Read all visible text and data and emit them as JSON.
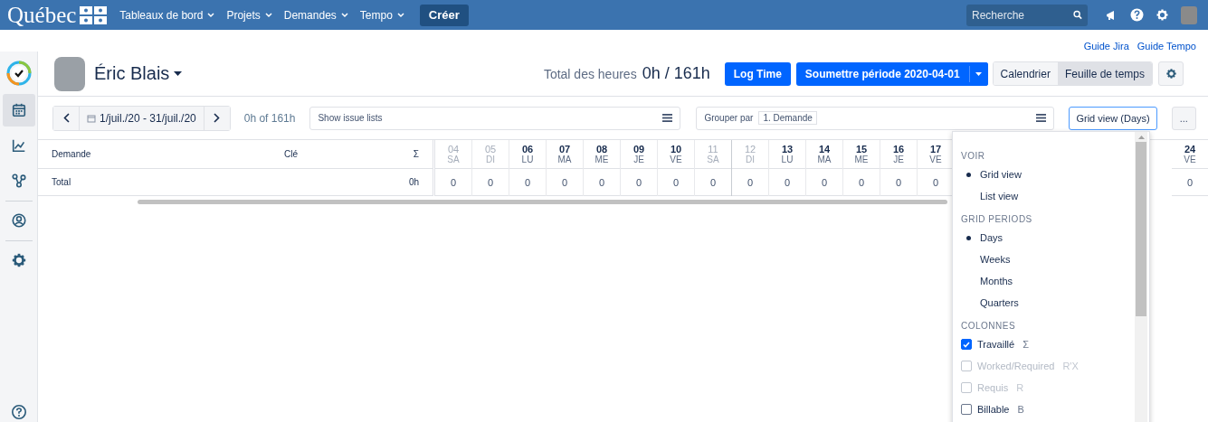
{
  "topnav": {
    "logo": "Québec",
    "menus": [
      {
        "label": "Tableaux de bord"
      },
      {
        "label": "Projets"
      },
      {
        "label": "Demandes"
      },
      {
        "label": "Tempo"
      }
    ],
    "create": "Créer",
    "search": {
      "placeholder": "Recherche"
    }
  },
  "links": [
    "Guide Jira",
    "Guide Tempo"
  ],
  "sidebar": {
    "items": [
      {
        "selected": true
      },
      {
        "selected": false
      },
      {
        "selected": false
      },
      {
        "selected": false
      },
      {
        "selected": false
      }
    ]
  },
  "header": {
    "user": "Éric Blais",
    "total_label": "Total des heures",
    "total_value": "0h / 161h",
    "log_time": "Log Time",
    "submit": "Soumettre période 2020-04-01",
    "view_tabs": [
      {
        "label": "Calendrier",
        "selected": false
      },
      {
        "label": "Feuille de temps",
        "selected": true
      }
    ]
  },
  "toolbar": {
    "date_range": "1/juil./20 - 31/juil./20",
    "hours": "0h of 161h",
    "issue_lists": "Show issue lists",
    "group_label": "Grouper par",
    "group_tag": "1. Demande",
    "view_button": "Grid view (Days)",
    "more": "..."
  },
  "table": {
    "columns": [
      "Demande",
      "Clé",
      "Σ"
    ],
    "total_row": {
      "label": "Total",
      "sum": "0h"
    },
    "days": [
      {
        "num": "04",
        "day": "SA",
        "weekend": true,
        "total": "0"
      },
      {
        "num": "05",
        "day": "DI",
        "weekend": true,
        "total": "0"
      },
      {
        "num": "06",
        "day": "LU",
        "weekend": false,
        "total": "0"
      },
      {
        "num": "07",
        "day": "MA",
        "weekend": false,
        "total": "0"
      },
      {
        "num": "08",
        "day": "ME",
        "weekend": false,
        "total": "0"
      },
      {
        "num": "09",
        "day": "JE",
        "weekend": false,
        "total": "0"
      },
      {
        "num": "10",
        "day": "VE",
        "weekend": false,
        "total": "0"
      },
      {
        "num": "11",
        "day": "SA",
        "weekend": true,
        "total": "0"
      },
      {
        "num": "12",
        "day": "DI",
        "weekend": true,
        "total": "0"
      },
      {
        "num": "13",
        "day": "LU",
        "weekend": false,
        "total": "0"
      },
      {
        "num": "14",
        "day": "MA",
        "weekend": false,
        "total": "0"
      },
      {
        "num": "15",
        "day": "ME",
        "weekend": false,
        "total": "0"
      },
      {
        "num": "16",
        "day": "JE",
        "weekend": false,
        "total": "0"
      },
      {
        "num": "17",
        "day": "VE",
        "weekend": false,
        "total": "0"
      }
    ],
    "days_after": [
      {
        "num": "24",
        "day": "VE",
        "weekend": false,
        "total": "0"
      }
    ]
  },
  "view_menu": {
    "sections": [
      {
        "title": "VOIR",
        "items": [
          {
            "kind": "radio",
            "label": "Grid view",
            "selected": true
          },
          {
            "kind": "radio",
            "label": "List view",
            "selected": false
          }
        ]
      },
      {
        "title": "GRID PERIODS",
        "items": [
          {
            "kind": "radio",
            "label": "Days",
            "selected": true
          },
          {
            "kind": "radio",
            "label": "Weeks",
            "selected": false
          },
          {
            "kind": "radio",
            "label": "Months",
            "selected": false
          },
          {
            "kind": "radio",
            "label": "Quarters",
            "selected": false
          }
        ]
      },
      {
        "title": "COLONNES",
        "items": [
          {
            "kind": "checkbox",
            "label": "Travaillé",
            "suffix": "Σ",
            "checked": true,
            "disabled": false
          },
          {
            "kind": "checkbox",
            "label": "Worked/Required",
            "suffix": "R'X",
            "checked": false,
            "disabled": true
          },
          {
            "kind": "checkbox",
            "label": "Requis",
            "suffix": "R",
            "checked": false,
            "disabled": true
          },
          {
            "kind": "checkbox",
            "label": "Billable",
            "suffix": "B",
            "checked": false,
            "disabled": false
          }
        ]
      }
    ]
  }
}
